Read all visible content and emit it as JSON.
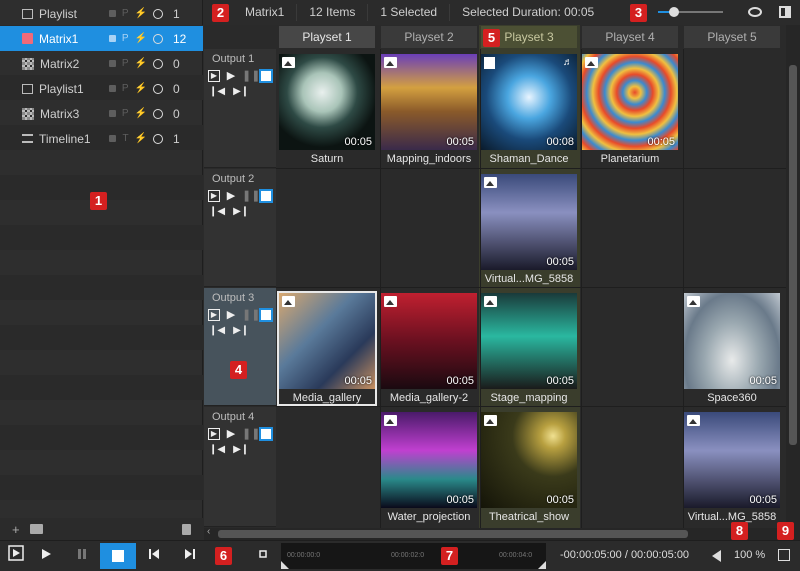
{
  "left_panel": {
    "items": [
      {
        "name": "Playlist",
        "icon": "playlist-icon",
        "flags": [
          "lock",
          "P",
          "flash"
        ],
        "count": "1",
        "selected": false
      },
      {
        "name": "Matrix1",
        "icon": "matrix-icon",
        "flags": [
          "lock",
          "P",
          "flash"
        ],
        "count": "12",
        "selected": true
      },
      {
        "name": "Matrix2",
        "icon": "matrix-icon",
        "flags": [
          "lock",
          "P",
          "flash"
        ],
        "count": "0",
        "selected": false
      },
      {
        "name": "Playlist1",
        "icon": "playlist-icon",
        "flags": [
          "lock",
          "P",
          "flash"
        ],
        "count": "0",
        "selected": false
      },
      {
        "name": "Matrix3",
        "icon": "matrix-icon",
        "flags": [
          "lock",
          "P",
          "flash"
        ],
        "count": "0",
        "selected": false
      },
      {
        "name": "Timeline1",
        "icon": "timeline-icon",
        "flags": [
          "lock",
          "T",
          "flash"
        ],
        "count": "1",
        "selected": false
      }
    ],
    "footer": {
      "add": "+",
      "folder_icon": "folder-icon",
      "trash_icon": "trash-icon"
    }
  },
  "topbar": {
    "matrix_name": "Matrix1",
    "items": "12 Items",
    "selected": "1 Selected",
    "selected_duration": "Selected Duration: 00:05"
  },
  "columns": [
    "Playset 1",
    "Playset 2",
    "Playset 3",
    "Playset 4",
    "Playset 5"
  ],
  "outputs": [
    "Output 1",
    "Output 2",
    "Output 3",
    "Output 4"
  ],
  "cells": [
    {
      "row": 0,
      "col": 0,
      "name": "Saturn",
      "duration": "00:05",
      "kind": "image"
    },
    {
      "row": 0,
      "col": 1,
      "name": "Mapping_indoors",
      "duration": "00:05",
      "kind": "image"
    },
    {
      "row": 0,
      "col": 2,
      "name": "Shaman_Dance",
      "duration": "00:08",
      "kind": "video"
    },
    {
      "row": 0,
      "col": 3,
      "name": "Planetarium",
      "duration": "00:05",
      "kind": "image"
    },
    {
      "row": 1,
      "col": 2,
      "name": "Virtual...MG_5858",
      "duration": "00:05",
      "kind": "image"
    },
    {
      "row": 2,
      "col": 0,
      "name": "Media_gallery",
      "duration": "00:05",
      "kind": "image",
      "selected": true
    },
    {
      "row": 2,
      "col": 1,
      "name": "Media_gallery-2",
      "duration": "00:05",
      "kind": "image"
    },
    {
      "row": 2,
      "col": 2,
      "name": "Stage_mapping",
      "duration": "00:05",
      "kind": "image"
    },
    {
      "row": 2,
      "col": 4,
      "name": "Space360",
      "duration": "00:05",
      "kind": "image"
    },
    {
      "row": 3,
      "col": 1,
      "name": "Water_projection",
      "duration": "00:05",
      "kind": "image"
    },
    {
      "row": 3,
      "col": 2,
      "name": "Theatrical_show",
      "duration": "00:05",
      "kind": "image"
    },
    {
      "row": 3,
      "col": 4,
      "name": "Virtual...MG_5858",
      "duration": "00:05",
      "kind": "image"
    }
  ],
  "bottom": {
    "ticks": [
      "00:00:00:0",
      "00:00:02:0",
      "00:00:04:0"
    ],
    "timecode": "-00:00:05:00 / 00:00:05:00",
    "volume": "100 %"
  },
  "badges": [
    "1",
    "2",
    "3",
    "4",
    "5",
    "6",
    "7",
    "8",
    "9"
  ],
  "colors": {
    "accent": "#1f8fe0",
    "badge": "#d42020",
    "playset3_bg": "#3a3d2c"
  }
}
